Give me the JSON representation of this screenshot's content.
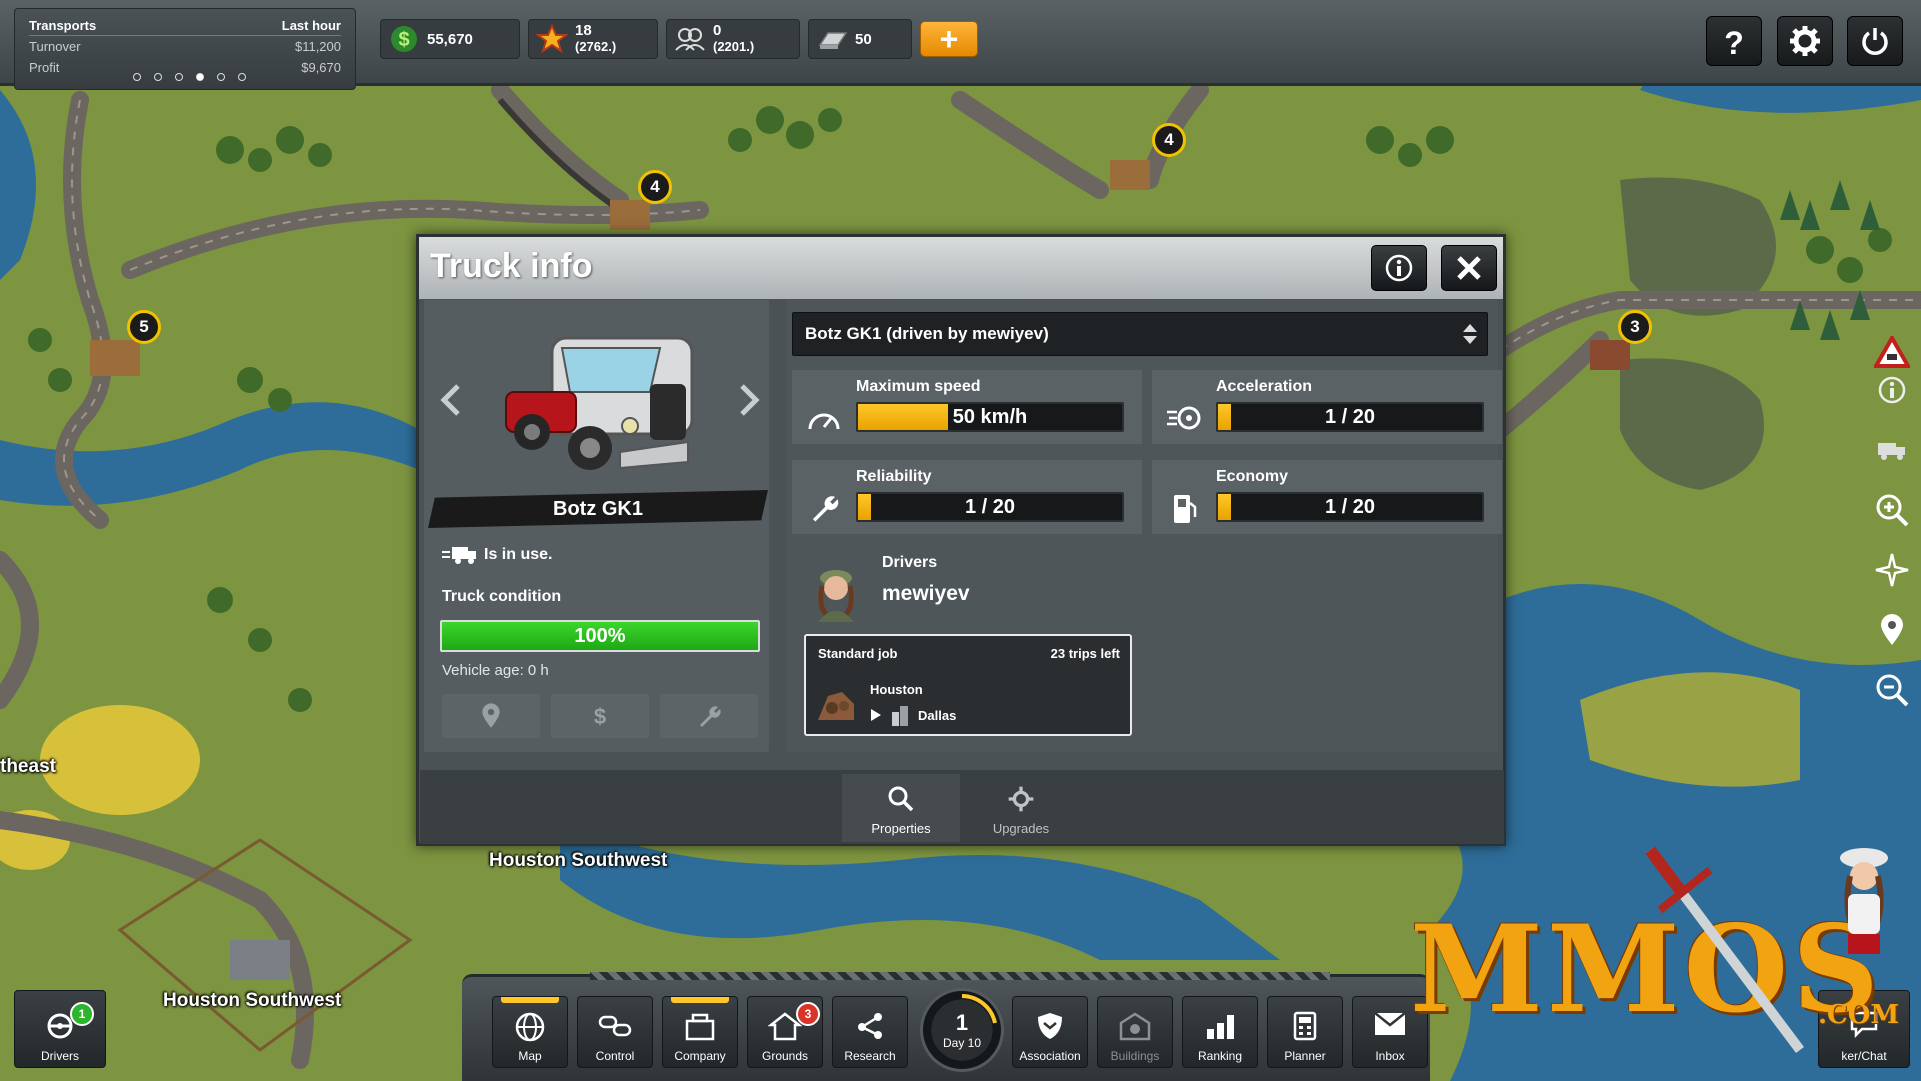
{
  "topbar": {
    "transports": {
      "title": "Transports",
      "period": "Last hour",
      "turnover_label": "Turnover",
      "turnover_value": "$11,200",
      "profit_label": "Profit",
      "profit_value": "$9,670"
    },
    "money": "55,670",
    "stars": "18",
    "stars_rank": "(2762.)",
    "people": "0",
    "people_rank": "(2201.)",
    "bars": "50",
    "plus_label": "+"
  },
  "map_labels": {
    "southeast": "theast",
    "houston_sw_1": "Houston Southwest",
    "houston_sw_2": "Houston Southwest"
  },
  "badges": {
    "a": "4",
    "b": "4",
    "c": "5",
    "d": "3"
  },
  "dialog": {
    "title": "Truck info",
    "truck_selector": "Botz GK1 (driven by mewiyev)",
    "truck_name": "Botz GK1",
    "in_use": "Is in use.",
    "condition_label": "Truck condition",
    "condition_value": "100%",
    "condition_fraction": 1.0,
    "vehicle_age": "Vehicle age: 0 h",
    "stats": {
      "speed": {
        "label": "Maximum speed",
        "value": "50 km/h",
        "fraction": 0.34
      },
      "accel": {
        "label": "Acceleration",
        "value": "1 / 20",
        "fraction": 0.05
      },
      "reliability": {
        "label": "Reliability",
        "value": "1 / 20",
        "fraction": 0.05
      },
      "economy": {
        "label": "Economy",
        "value": "1 / 20",
        "fraction": 0.05
      }
    },
    "drivers_label": "Drivers",
    "driver_name": "mewiyev",
    "job": {
      "type": "Standard job",
      "trips": "23 trips left",
      "from": "Houston",
      "to": "Dallas"
    },
    "tabs": {
      "properties": "Properties",
      "upgrades": "Upgrades"
    }
  },
  "bottombar": {
    "drivers": "Drivers",
    "drivers_badge": "1",
    "map": "Map",
    "control": "Control",
    "company": "Company",
    "grounds": "Grounds",
    "grounds_badge": "3",
    "research": "Research",
    "day_number": "1",
    "day_label": "Day 10",
    "association": "Association",
    "buildings": "Buildings",
    "ranking": "Ranking",
    "planner": "Planner",
    "inbox": "Inbox",
    "chat": "ker/Chat"
  },
  "watermark": {
    "text": "MMOS",
    "suffix": ".COM"
  },
  "colors": {
    "accent": "#ffc72a",
    "condition": "#2cc21d",
    "plus": "#f29a0f"
  }
}
